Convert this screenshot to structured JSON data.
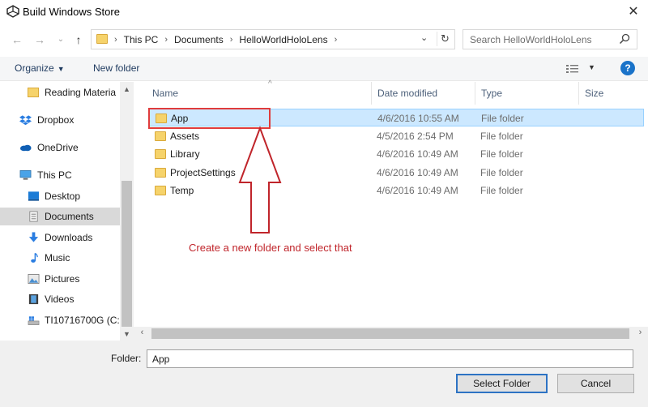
{
  "window": {
    "title": "Build Windows Store"
  },
  "address": {
    "crumbs": [
      "This PC",
      "Documents",
      "HelloWorldHoloLens"
    ],
    "search_placeholder": "Search HelloWorldHoloLens"
  },
  "toolbar": {
    "organize_label": "Organize",
    "new_folder_label": "New folder"
  },
  "sidebar": {
    "items": [
      {
        "label": "Reading Materia",
        "icon": "folder-icon"
      },
      {
        "label": "Dropbox",
        "icon": "dropbox-icon"
      },
      {
        "label": "OneDrive",
        "icon": "onedrive-icon"
      },
      {
        "label": "This PC",
        "icon": "computer-icon"
      },
      {
        "label": "Desktop",
        "icon": "desktop-icon"
      },
      {
        "label": "Documents",
        "icon": "documents-icon"
      },
      {
        "label": "Downloads",
        "icon": "downloads-icon"
      },
      {
        "label": "Music",
        "icon": "music-icon"
      },
      {
        "label": "Pictures",
        "icon": "pictures-icon"
      },
      {
        "label": "Videos",
        "icon": "videos-icon"
      },
      {
        "label": "TI10716700G (C:)",
        "icon": "drive-icon"
      }
    ]
  },
  "columns": {
    "name": "Name",
    "date": "Date modified",
    "type": "Type",
    "size": "Size"
  },
  "files": [
    {
      "name": "App",
      "date": "4/6/2016 10:55 AM",
      "type": "File folder"
    },
    {
      "name": "Assets",
      "date": "4/5/2016 2:54 PM",
      "type": "File folder"
    },
    {
      "name": "Library",
      "date": "4/6/2016 10:49 AM",
      "type": "File folder"
    },
    {
      "name": "ProjectSettings",
      "date": "4/6/2016 10:49 AM",
      "type": "File folder"
    },
    {
      "name": "Temp",
      "date": "4/6/2016 10:49 AM",
      "type": "File folder"
    }
  ],
  "annotation": {
    "text": "Create a new folder and select that",
    "color": "#c0252b"
  },
  "bottom": {
    "folder_label": "Folder:",
    "folder_value": "App",
    "select_label": "Select Folder",
    "cancel_label": "Cancel"
  },
  "colors": {
    "accent": "#2d73c4",
    "selection": "#cce8ff",
    "highlight_box": "#e03c3c"
  }
}
